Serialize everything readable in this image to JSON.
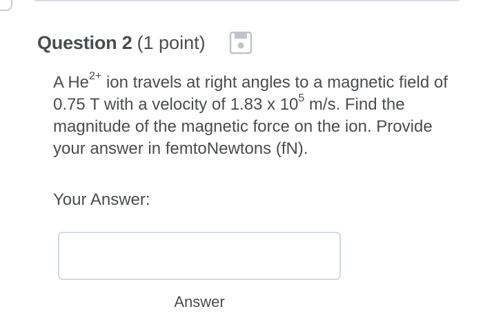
{
  "question": {
    "title": "Question 2",
    "points": "(1 point)",
    "save_icon": "save-disk-icon",
    "body": {
      "t1": "A He",
      "sup1": "2+",
      "t2": " ion travels at right angles to a magnetic field of 0.75 T with a velocity of 1.83 x 10",
      "sup2": "5",
      "t3": " m/s. Find the magnitude of the magnetic force on the ion. Provide your answer in femtoNewtons (fN)."
    }
  },
  "answer": {
    "label": "Your Answer:",
    "value": "",
    "placeholder": "",
    "button_label": "Answer"
  },
  "colors": {
    "text": "#494c4e",
    "input_border": "#d3d9e3",
    "divider": "#d9dce3"
  }
}
